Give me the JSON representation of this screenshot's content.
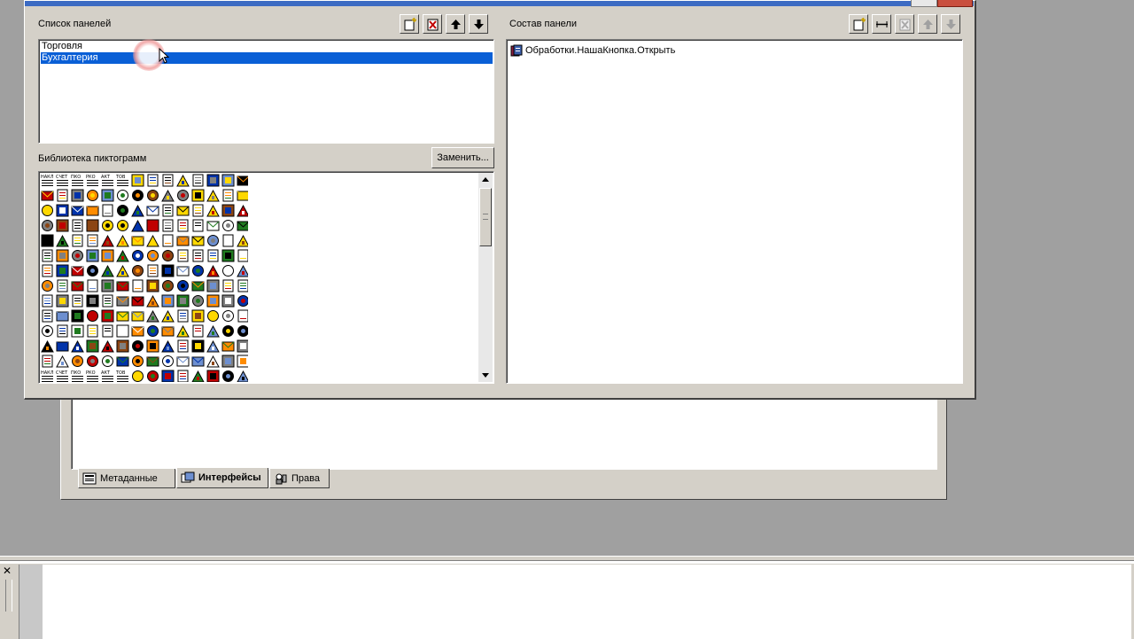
{
  "panels": {
    "list_title": "Список панелей",
    "items": [
      "Торговля",
      "Бухгалтерия"
    ],
    "selected_index": 1
  },
  "composition": {
    "title": "Состав панели",
    "items": [
      "Обработки.НашаКнопка.Открыть"
    ]
  },
  "library": {
    "title": "Библиотека пиктограмм",
    "replace_button": "Заменить...",
    "scroll_position": 0.12
  },
  "tabs": [
    {
      "label": "Метаданные",
      "icon": "metadata-icon"
    },
    {
      "label": "Интерфейсы",
      "icon": "interfaces-icon"
    },
    {
      "label": "Права",
      "icon": "rights-icon"
    }
  ],
  "active_tab": 1,
  "icon_grid": {
    "row0_labels": [
      "НАКЛ",
      "СЧЕТ",
      "ПКО",
      "РКО",
      "АКТ",
      "ТОВ"
    ],
    "last_row_labels": [
      "НАКЛ",
      "СЧЕТ",
      "ПКО",
      "РКО",
      "АКТ",
      "ТОВ"
    ]
  },
  "colors": {
    "face": "#d4d0c8",
    "selection": "#0a5fd6",
    "desktop": "#a0a0a0"
  },
  "toolbar_icons": {
    "left": [
      "new-panel-icon",
      "delete-panel-icon",
      "move-up-icon",
      "move-down-icon"
    ],
    "right": [
      "new-button-icon",
      "separator-icon",
      "delete-button-icon",
      "move-up-icon",
      "move-down-icon"
    ]
  }
}
